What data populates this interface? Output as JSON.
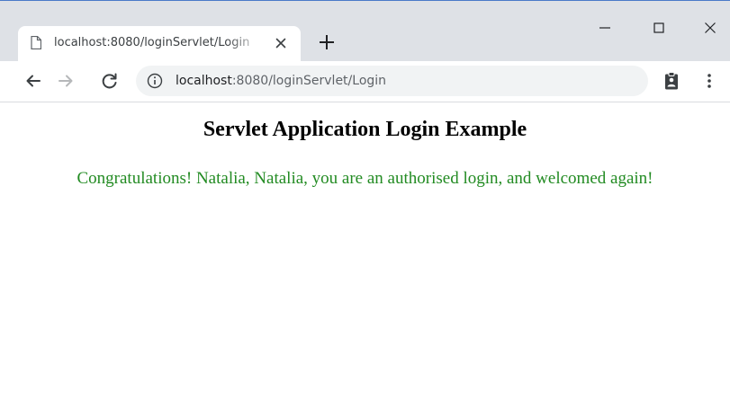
{
  "browser": {
    "tab": {
      "title": "localhost:8080/loginServlet/Login"
    },
    "address_bar": {
      "host": "localhost",
      "rest": ":8080/loginServlet/Login"
    }
  },
  "page": {
    "heading": "Servlet Application Login Example",
    "message": "Congratulations! Natalia, Natalia, you are an authorised login, and welcomed again!",
    "message_color": "#228b22"
  },
  "icons": {
    "tab": "page-icon",
    "tab_close": "close-icon",
    "new_tab": "plus-icon",
    "minimize": "minimize-icon",
    "maximize": "maximize-icon",
    "close_window": "close-icon",
    "back": "back-arrow-icon",
    "forward": "forward-arrow-icon",
    "reload": "reload-icon",
    "site_info": "info-icon",
    "extension": "clipboard-icon",
    "menu": "kebab-menu-icon"
  }
}
